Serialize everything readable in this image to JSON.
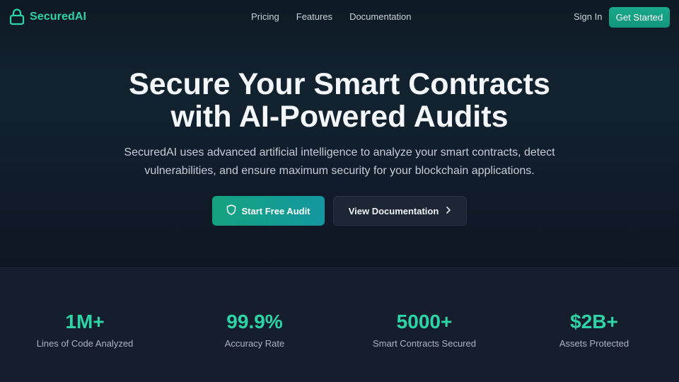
{
  "brand": {
    "name": "SecuredAI",
    "accent": "#2dd4a7"
  },
  "nav": {
    "links": [
      "Pricing",
      "Features",
      "Documentation"
    ],
    "sign_in": "Sign In",
    "get_started": "Get Started"
  },
  "hero": {
    "title_line1": "Secure Your Smart Contracts",
    "title_line2": "with AI-Powered Audits",
    "subtitle_line1": "SecuredAI uses advanced artificial intelligence to analyze your smart contracts, detect",
    "subtitle_line2": "vulnerabilities, and ensure maximum security for your blockchain applications.",
    "primary_button": "Start Free Audit",
    "secondary_button": "View Documentation"
  },
  "stats": [
    {
      "value": "1M+",
      "label": "Lines of Code Analyzed"
    },
    {
      "value": "99.9%",
      "label": "Accuracy Rate"
    },
    {
      "value": "5000+",
      "label": "Smart Contracts Secured"
    },
    {
      "value": "$2B+",
      "label": "Assets Protected"
    }
  ],
  "icons": {
    "logo": "lock-icon",
    "primary_button": "shield-icon",
    "secondary_button": "chevron-right-icon"
  }
}
